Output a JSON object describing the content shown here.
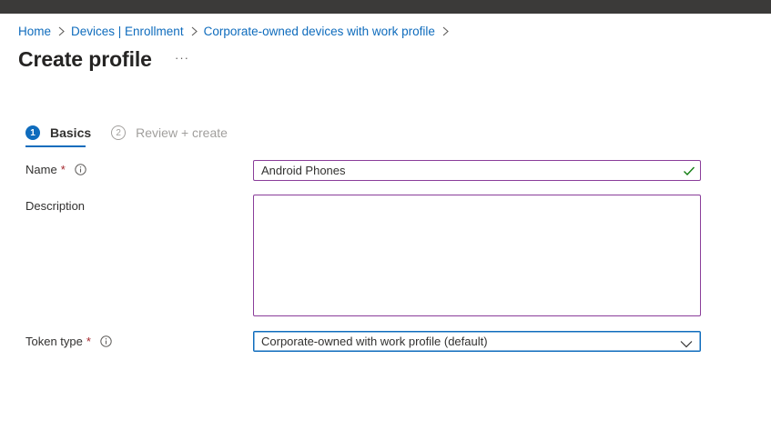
{
  "breadcrumb": [
    {
      "label": "Home"
    },
    {
      "label": "Devices | Enrollment"
    },
    {
      "label": "Corporate-owned devices with work profile"
    }
  ],
  "page": {
    "title": "Create profile",
    "more_label": "···"
  },
  "wizard": {
    "steps": [
      {
        "number": "1",
        "label": "Basics",
        "state": "active"
      },
      {
        "number": "2",
        "label": "Review + create",
        "state": "inactive"
      }
    ]
  },
  "form": {
    "name": {
      "label": "Name",
      "required_mark": "*",
      "value": "Android Phones",
      "valid": true
    },
    "description": {
      "label": "Description",
      "value": ""
    },
    "token_type": {
      "label": "Token type",
      "required_mark": "*",
      "selected": "Corporate-owned with work profile (default)"
    }
  },
  "colors": {
    "accent": "#0f6cbd",
    "input_border": "#8a3d9a",
    "required": "#a4262c",
    "valid_check": "#107c10",
    "topbar": "#3b3a39"
  }
}
